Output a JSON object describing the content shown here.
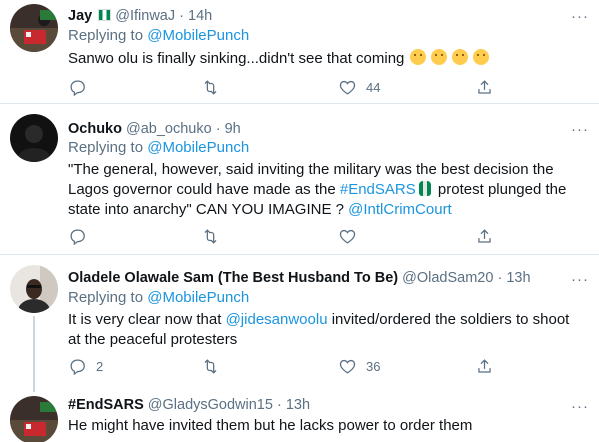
{
  "tweets": [
    {
      "name": "Jay",
      "handle": "@IfinwaJ",
      "time": "14h",
      "replying_prefix": "Replying to",
      "replying_to": "@MobilePunch",
      "text": "Sanwo olu is finally sinking...didn't see that coming",
      "likes": "44"
    },
    {
      "name": "Ochuko",
      "handle": "@ab_ochuko",
      "time": "9h",
      "replying_prefix": "Replying to",
      "replying_to": "@MobilePunch",
      "text_part1": "\"The general, however, said inviting the military was the best decision the Lagos governor could have made as the",
      "hashtag": "#EndSARS",
      "text_part2": "protest plunged the state into anarchy\"   CAN YOU IMAGINE ?",
      "mention": "@IntlCrimCourt"
    },
    {
      "name": "Oladele Olawale Sam (The Best Husband To Be)",
      "handle": "@OladSam20",
      "time": "13h",
      "replying_prefix": "Replying to",
      "replying_to": "@MobilePunch",
      "text_part1": "It is very clear now that",
      "mention": "@jidesanwoolu",
      "text_part2": "invited/ordered the soldiers to shoot at the peaceful protesters",
      "replies": "2",
      "likes": "36"
    },
    {
      "name": "#EndSARS",
      "handle": "@GladysGodwin15",
      "time": "13h",
      "text": "He might have invited them but he lacks power to order them"
    }
  ],
  "separator": "·",
  "more_label": "···",
  "colors": {
    "link": "#1b95e0",
    "muted": "#5b7083",
    "divider": "#e1e8ed"
  }
}
